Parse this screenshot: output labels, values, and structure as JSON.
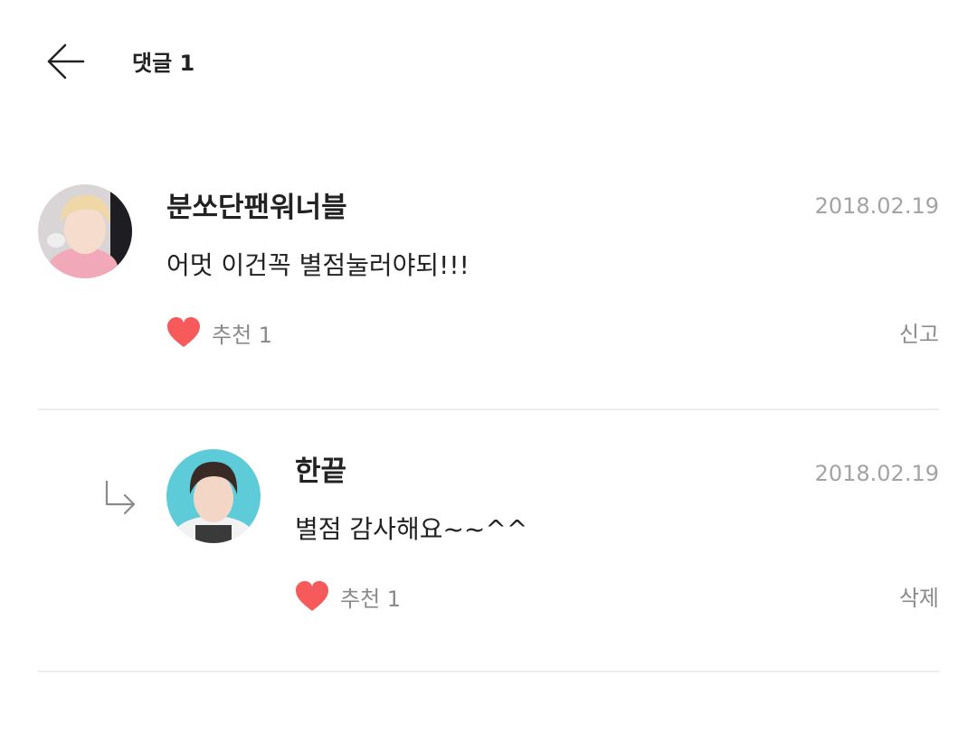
{
  "header": {
    "back_icon": "arrow-left-icon",
    "title": "댓글 1"
  },
  "comments": [
    {
      "username": "분쏘단팬워너블",
      "date": "2018.02.19",
      "text": "어멋 이건꼭 별점눌러야되!!!",
      "like_label": "추천 1",
      "action_label": "신고",
      "avatar_bg": "#d9d4d6"
    },
    {
      "username": "한끝",
      "date": "2018.02.19",
      "text": "별점 감사해요~~^^",
      "like_label": "추천 1",
      "action_label": "삭제",
      "avatar_bg": "#5ecbd8",
      "is_reply": true
    }
  ],
  "colors": {
    "heart": "#f65a5a",
    "muted": "#8a8a8a",
    "date": "#a3a3a3",
    "divider": "#ececec"
  }
}
